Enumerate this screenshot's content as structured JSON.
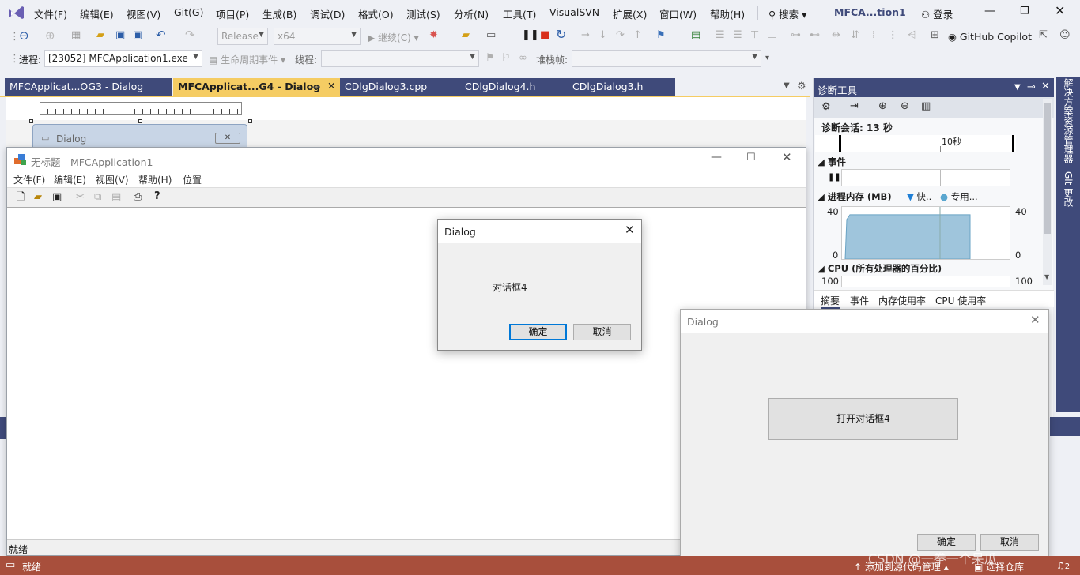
{
  "colors": {
    "accent": "#3f4a7a",
    "active_tab": "#f5cc63",
    "status_bar": "#a84f3c",
    "chrome": "#eef0f5"
  },
  "menubar": {
    "items": [
      "文件(F)",
      "编辑(E)",
      "视图(V)",
      "Git(G)",
      "项目(P)",
      "生成(B)",
      "调试(D)",
      "格式(O)",
      "测试(S)",
      "分析(N)",
      "工具(T)",
      "VisualSVN",
      "扩展(X)",
      "窗口(W)",
      "帮助(H)"
    ],
    "search": "搜索",
    "title": "MFCA...tion1",
    "login": "登录"
  },
  "toolbar": {
    "config": "Release",
    "platform": "x64",
    "continue": "继续(C)",
    "copilot": "GitHub Copilot"
  },
  "debugbar": {
    "process_label": "进程:",
    "process_value": "[23052] MFCApplication1.exe",
    "lifecycle": "生命周期事件",
    "thread_label": "线程:",
    "stack_label": "堆栈帧:"
  },
  "doc_tabs": [
    {
      "label": "MFCApplicat...OG3 - Dialog"
    },
    {
      "label": "MFCApplicat...G4 - Dialog",
      "active": true
    },
    {
      "label": "CDlgDialog3.cpp"
    },
    {
      "label": "CDlgDialog4.h"
    },
    {
      "label": "CDlgDialog3.h"
    }
  ],
  "designer": {
    "dialog_title": "Dialog"
  },
  "app_window": {
    "title": "无标题 - MFCApplication1",
    "menu": [
      "文件(F)",
      "编辑(E)",
      "视图(V)",
      "帮助(H)",
      "位置"
    ],
    "status": "就绪"
  },
  "dialog4": {
    "title": "Dialog",
    "text": "对话框4",
    "ok": "确定",
    "cancel": "取消"
  },
  "main_dialog": {
    "title": "Dialog",
    "open_button": "打开对话框4",
    "ok": "确定",
    "cancel": "取消"
  },
  "diagnostics": {
    "title": "诊断工具",
    "session": "诊断会话: 13 秒",
    "timeline_tick": "10秒",
    "events": "事件",
    "memory": "进程内存 (MB)",
    "legend_fast": "快..",
    "legend_private": "专用...",
    "mem_max": "40",
    "mem_min": "0",
    "mem_max_r": "40",
    "mem_min_r": "0",
    "cpu": "CPU (所有处理器的百分比)",
    "cpu_max": "100",
    "cpu_max_r": "100",
    "tabs": [
      "摘要",
      "事件",
      "内存使用率",
      "CPU 使用率"
    ],
    "memory_fill_fraction": 0.85
  },
  "right_rail": {
    "solution": "解决方案资源管理器",
    "git": "Git 更改"
  },
  "statusbar": {
    "ready": "就绪",
    "source_control": "添加到源代码管理",
    "repo": "选择仓库",
    "notifications": "2",
    "watermark": "CSDN @一拳一个呆瓜"
  }
}
